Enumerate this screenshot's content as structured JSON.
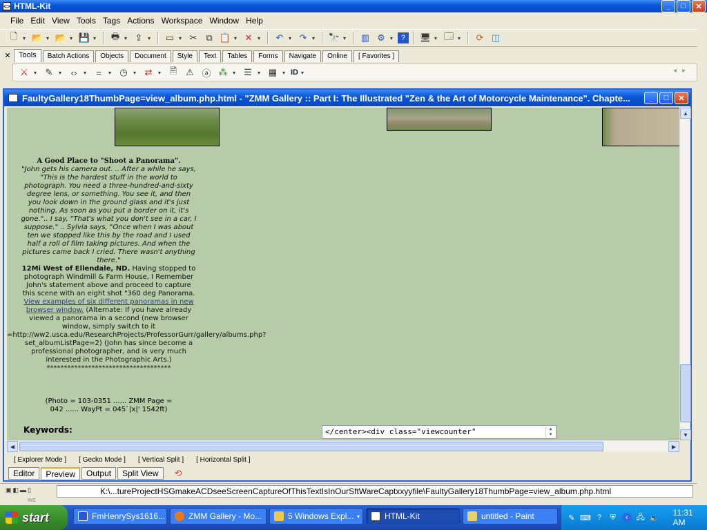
{
  "app": {
    "title": "HTML-Kit",
    "window_buttons": {
      "minimize": "_",
      "maximize": "□",
      "close": "✕"
    }
  },
  "menu": [
    "File",
    "Edit",
    "View",
    "Tools",
    "Tags",
    "Actions",
    "Workspace",
    "Window",
    "Help"
  ],
  "tool_tabs": [
    "Tools",
    "Batch Actions",
    "Objects",
    "Document",
    "Style",
    "Text",
    "Tables",
    "Forms",
    "Navigate",
    "Online",
    "[ Favorites ]"
  ],
  "toolbar2": {
    "id_label": "ID"
  },
  "document": {
    "title": "FaultyGallery18ThumbPage=view_album.php.html - \"ZMM Gallery :: Part I: The Illustrated \"Zen & the Art of Motorcycle Maintenance\". Chapte...",
    "caption": {
      "heading": "A Good Place to \"Shoot a Panorama\".",
      "quote": "\"John gets his camera out. .. After a while he says, \"This is the hardest stuff in the world to photograph. You need a three-hundred-and-sixty degree lens, or something. You see it, and then you look down in the ground glass and it's just nothing. As soon as you put a border on it, it's gone.\".. I say, \"That's what you don't see in a car, I suppose.\" .. Sylvia says, \"Once when I was about ten we stopped like this by the road and I used half a roll of film taking pictures. And when the pictures came back I cried. There wasn't anything there.\"",
      "location": "12Mi West of Ellendale, ND.",
      "body": "Having stopped to photograph Windmill & Farm House, I Remember John's statement above and proceed to capture this scene with an eight shot \"360 deg Panorama.",
      "link": "View examples of six different panoramas in new browser window.",
      "alt_text": "(Alternate: If you have already viewed a panorama in a second (new browser window, simply switch to it",
      "url": "=http://ww2.usca.edu/ResearchProjects/ProfessorGurr/gallery/albums.php?",
      "alt_tail": "set_albumListPage=2) (John has since become a professional photographer, and is very much interested in the Photographic Arts.)",
      "stars": "************************************"
    },
    "photo_info_line1": "(Photo = 103-0351 ...... ZMM Page =",
    "photo_info_line2": "042 ...... WayPt = 045`|x|' 1542ft)",
    "keywords_label": "Keywords:",
    "code_snippet": "</center><div class=\"viewcounter\""
  },
  "modes": [
    "[ Explorer Mode ]",
    "[ Gecko Mode ]",
    "[ Vertical Split ]",
    "[ Horizontal Split ]"
  ],
  "view_tabs": [
    "Editor",
    "Preview",
    "Output",
    "Split View"
  ],
  "status": {
    "path": "K:\\...tureProjectHSGmakeACDseeScreenCaptureOfThisTextIsInOurSftWareCaptxxyyfile\\FaultyGallery18ThumbPage=view_album.php.html",
    "strip_text": "INS"
  },
  "taskbar": {
    "start": "start",
    "tasks": [
      "FmHenrySys1616...",
      "ZMM Gallery - Mo...",
      "5 Windows Expl...",
      "HTML-Kit",
      "untitled - Paint"
    ],
    "clock": "11:31 AM"
  },
  "colors": {
    "xp_blue": "#0a58d8",
    "page_bg": "#b7cba8",
    "start_green": "#3a8f2c"
  }
}
